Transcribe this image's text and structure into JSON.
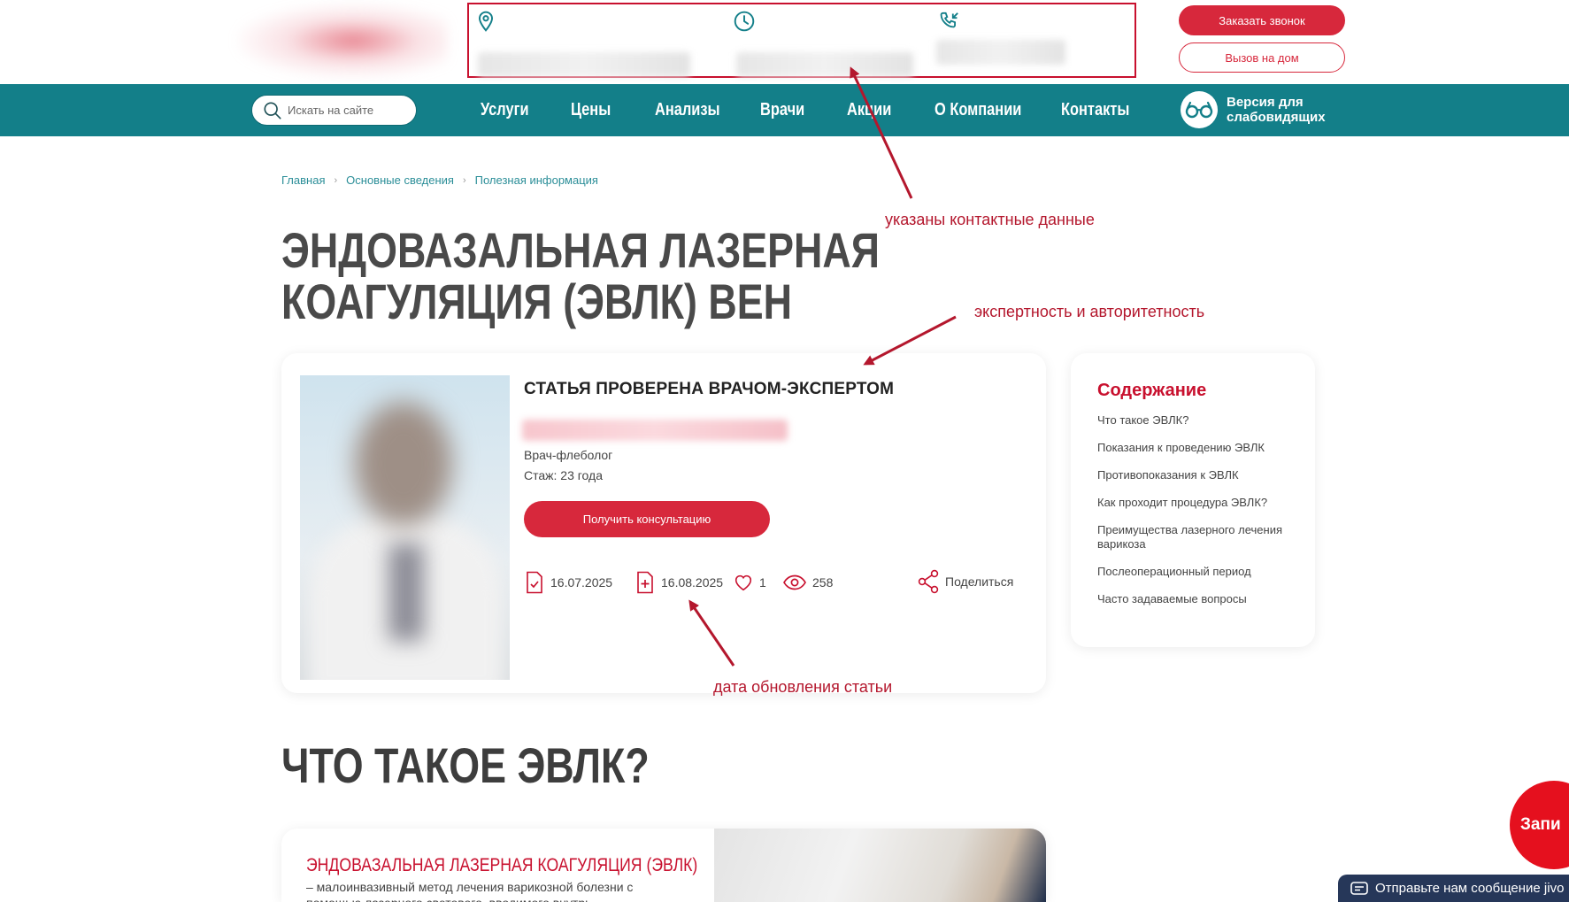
{
  "header": {
    "order_call": "Заказать звонок",
    "home_call": "Вызов на дом"
  },
  "nav": {
    "search_placeholder": "Искать на сайте",
    "items": [
      "Услуги",
      "Цены",
      "Анализы",
      "Врачи",
      "Акции",
      "О Компании",
      "Контакты"
    ],
    "low_vision": [
      "Версия для",
      "слабовидящих"
    ]
  },
  "breadcrumb": [
    "Главная",
    "Основные сведения",
    "Полезная информация"
  ],
  "page": {
    "title_line1": "Эндовазальная лазерная",
    "title_line2": "коагуляция (ЭВЛК) вен"
  },
  "expert": {
    "heading": "СТАТЬЯ ПРОВЕРЕНА ВРАЧОМ-ЭКСПЕРТОМ",
    "specialty": "Врач-флеболог",
    "experience": "Стаж: 23 года",
    "consult_button": "Получить консультацию",
    "published": "16.07.2025",
    "updated": "16.08.2025",
    "likes": "1",
    "views": "258",
    "share": "Поделиться"
  },
  "toc": {
    "title": "Содержание",
    "items": [
      "Что такое ЭВЛК?",
      "Показания к проведению ЭВЛК",
      "Противопоказания к ЭВЛК",
      "Как проходит процедура ЭВЛК?",
      "Преимущества лазерного лечения варикоза",
      "Послеоперационный период",
      "Часто задаваемые вопросы"
    ]
  },
  "section2": {
    "title": "ЧТО ТАКОЕ ЭВЛК?",
    "card_title": "ЭНДОВАЗАЛЬНАЯ ЛАЗЕРНАЯ КОАГУЛЯЦИЯ (ЭВЛК)",
    "card_text": "– малоинвазивный метод лечения варикозной болезни с помощью лазерного светового, вводимого внутрь"
  },
  "annotations": {
    "contacts": "указаны контактные данные",
    "expertise": "экспертность и авторитетность",
    "update_date": "дата обновления статьи"
  },
  "floating": {
    "fab_label": "Запи",
    "chat_label": "Отправьте нам сообщение  jivo"
  },
  "colors": {
    "accent_red": "#d7283c",
    "nav_teal": "#137f89",
    "annotation_red": "#b4172d"
  }
}
